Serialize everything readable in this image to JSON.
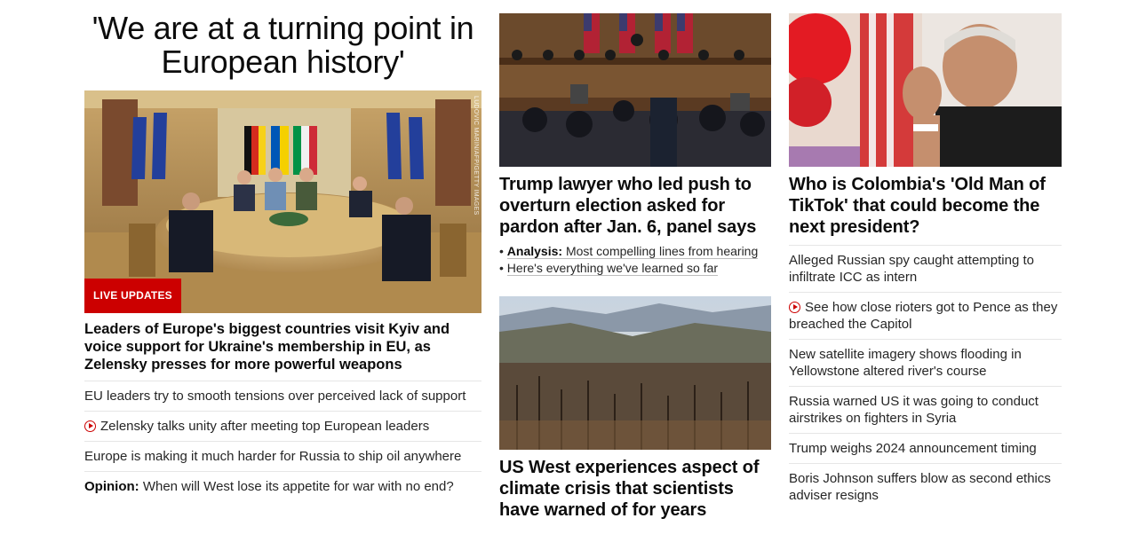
{
  "lead": {
    "title": "'We are at a turning point in European history'",
    "image_credit": "LUDOVIC MARIN/AFP/GETTY IMAGES",
    "badge": "LIVE UPDATES",
    "headline": "Leaders of Europe's biggest countries visit Kyiv and voice support for Ukraine's membership in EU, as Zelensky presses for more powerful weapons",
    "related": [
      {
        "text": "EU leaders try to smooth tensions over perceived lack of support",
        "video": false
      },
      {
        "text": "Zelensky talks unity after meeting top European leaders",
        "video": true
      },
      {
        "text": "Europe is making it much harder for Russia to ship oil anywhere",
        "video": false
      }
    ],
    "opinion": {
      "label": "Opinion:",
      "text": "When will West lose its appetite for war with no end?"
    }
  },
  "middle": {
    "story1": {
      "headline": "Trump lawyer who led push to overturn election asked for pardon after Jan. 6, panel says",
      "bullets": [
        {
          "prefix": "Analysis:",
          "text": "Most compelling lines from hearing"
        },
        {
          "prefix": "",
          "text": "Here's everything we've learned so far"
        }
      ]
    },
    "story2": {
      "headline": "US West experiences aspect of climate crisis that scientists have warned of for years"
    }
  },
  "right": {
    "story": {
      "headline": "Who is Colombia's 'Old Man of TikTok' that could become the next president?"
    },
    "list": [
      {
        "text": "Alleged Russian spy caught attempting to infiltrate ICC as intern",
        "video": false
      },
      {
        "text": "See how close rioters got to Pence as they breached the Capitol",
        "video": true
      },
      {
        "text": "New satellite imagery shows flooding in Yellowstone altered river's course",
        "video": false
      },
      {
        "text": "Russia warned US it was going to conduct airstrikes on fighters in Syria",
        "video": false
      },
      {
        "text": "Trump weighs 2024 announcement timing",
        "video": false
      },
      {
        "text": "Boris Johnson suffers blow as second ethics adviser resigns",
        "video": false
      }
    ]
  },
  "colors": {
    "accent": "#cc0000",
    "text": "#0c0c0c",
    "divider": "#e6e6e6"
  }
}
